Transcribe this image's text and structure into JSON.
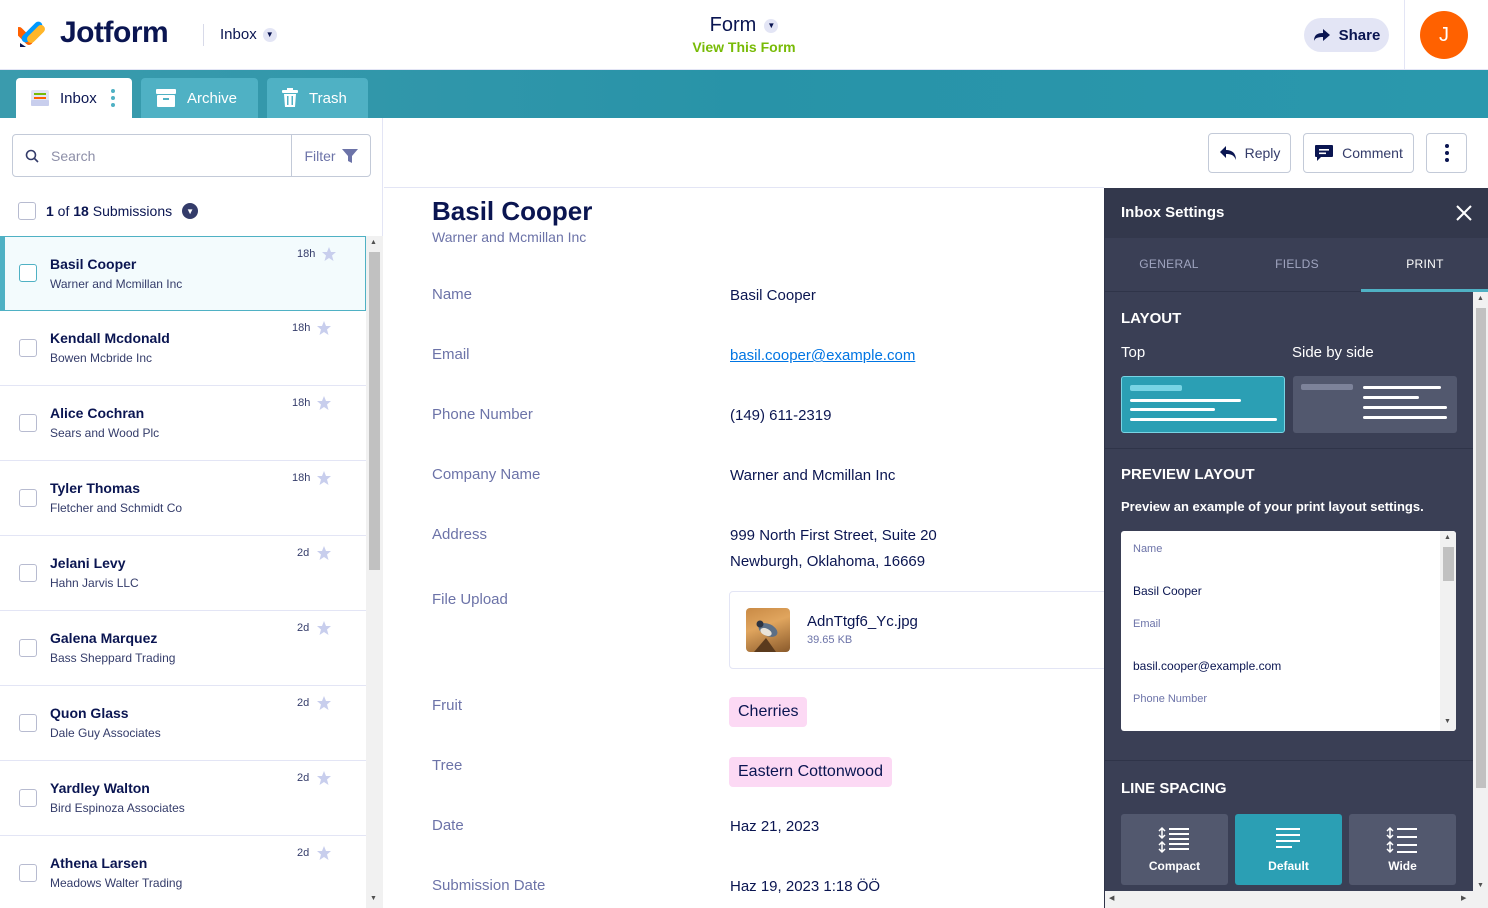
{
  "header": {
    "brand": "Jotform",
    "inbox_dropdown": "Inbox",
    "form_name": "Form",
    "view_form_link": "View This Form",
    "share_label": "Share",
    "avatar_initial": "J",
    "colors": {
      "accent": "#4fb1c4",
      "brand": "#0a1551",
      "avatar": "#ff6100",
      "link_green": "#78bb07"
    }
  },
  "tabs": [
    {
      "label": "Inbox",
      "icon": "inbox-icon",
      "active": true
    },
    {
      "label": "Archive",
      "icon": "archive-icon",
      "active": false
    },
    {
      "label": "Trash",
      "icon": "trash-icon",
      "active": false
    }
  ],
  "search": {
    "placeholder": "Search",
    "filter_label": "Filter"
  },
  "submissions_summary": {
    "selected": "1",
    "of_text": " of ",
    "total": "18",
    "suffix": " Submissions"
  },
  "submissions": [
    {
      "name": "Basil Cooper",
      "company": "Warner and Mcmillan Inc",
      "time": "18h",
      "selected": true
    },
    {
      "name": "Kendall Mcdonald",
      "company": "Bowen Mcbride Inc",
      "time": "18h",
      "selected": false
    },
    {
      "name": "Alice Cochran",
      "company": "Sears and Wood Plc",
      "time": "18h",
      "selected": false
    },
    {
      "name": "Tyler Thomas",
      "company": "Fletcher and Schmidt Co",
      "time": "18h",
      "selected": false
    },
    {
      "name": "Jelani Levy",
      "company": "Hahn Jarvis LLC",
      "time": "2d",
      "selected": false
    },
    {
      "name": "Galena Marquez",
      "company": "Bass Sheppard Trading",
      "time": "2d",
      "selected": false
    },
    {
      "name": "Quon Glass",
      "company": "Dale Guy Associates",
      "time": "2d",
      "selected": false
    },
    {
      "name": "Yardley Walton",
      "company": "Bird Espinoza Associates",
      "time": "2d",
      "selected": false
    },
    {
      "name": "Athena Larsen",
      "company": "Meadows Walter Trading",
      "time": "2d",
      "selected": false
    }
  ],
  "actions": {
    "reply": "Reply",
    "comment": "Comment"
  },
  "submission": {
    "name": "Basil Cooper",
    "company": "Warner and Mcmillan Inc",
    "fields": {
      "name": {
        "label": "Name",
        "value": "Basil Cooper"
      },
      "email": {
        "label": "Email",
        "value": "basil.cooper@example.com"
      },
      "phone": {
        "label": "Phone Number",
        "value": "(149) 611-2319"
      },
      "company": {
        "label": "Company Name",
        "value": "Warner and Mcmillan Inc"
      },
      "address": {
        "label": "Address",
        "line1": "999 North First Street, Suite 20",
        "line2": "Newburgh, Oklahoma, 16669"
      },
      "file": {
        "label": "File Upload",
        "filename": "AdnTtgf6_Yc.jpg",
        "size": "39.65 KB"
      },
      "fruit": {
        "label": "Fruit",
        "value": "Cherries"
      },
      "tree": {
        "label": "Tree",
        "value": "Eastern Cottonwood"
      },
      "date": {
        "label": "Date",
        "value": "Haz 21, 2023"
      },
      "submission_date": {
        "label": "Submission Date",
        "value": "Haz 19, 2023 1:18 ÖÖ"
      }
    }
  },
  "settings": {
    "title": "Inbox Settings",
    "tabs": [
      "GENERAL",
      "FIELDS",
      "PRINT"
    ],
    "active_tab": "PRINT",
    "layout": {
      "title": "LAYOUT",
      "option_top": "Top",
      "option_side": "Side by side",
      "selected": "Top"
    },
    "preview": {
      "title": "PREVIEW LAYOUT",
      "description": "Preview an example of your print layout settings.",
      "items": [
        {
          "label": "Name",
          "value": "Basil Cooper"
        },
        {
          "label": "Email",
          "value": "basil.cooper@example.com"
        },
        {
          "label": "Phone Number"
        }
      ]
    },
    "line_spacing": {
      "title": "LINE SPACING",
      "options": [
        "Compact",
        "Default",
        "Wide"
      ],
      "selected": "Default"
    }
  }
}
